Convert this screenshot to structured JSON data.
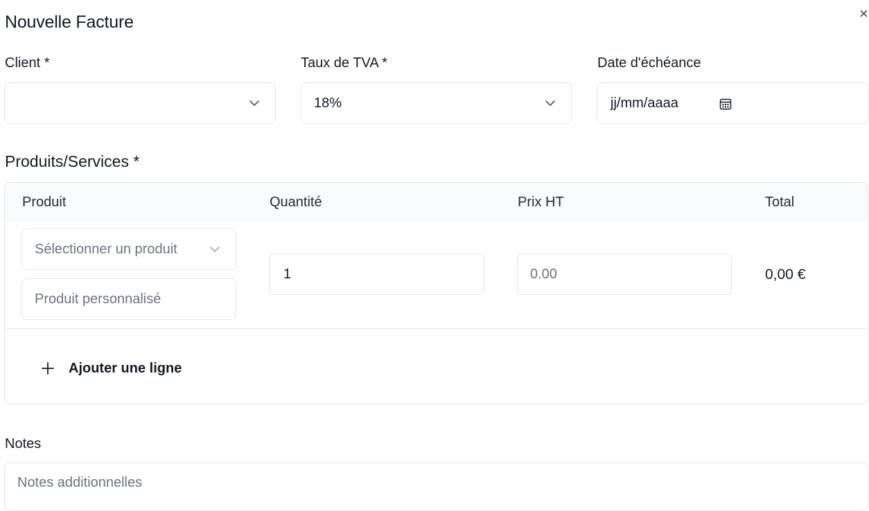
{
  "dialog": {
    "title": "Nouvelle Facture",
    "close_glyph": "×"
  },
  "form": {
    "client": {
      "label": "Client *",
      "value": ""
    },
    "tva": {
      "label": "Taux de TVA *",
      "value": "18%"
    },
    "due_date": {
      "label": "Date d'échéance",
      "placeholder": "jj/mm/aaaa",
      "icon": "calendar-icon"
    }
  },
  "products": {
    "section_title": "Produits/Services *",
    "columns": [
      "Produit",
      "Quantité",
      "Prix HT",
      "Total"
    ],
    "rows": [
      {
        "product_select_placeholder": "Sélectionner un produit",
        "custom_product_placeholder": "Produit personnalisé",
        "quantity": "1",
        "price_placeholder": "0.00",
        "total": "0,00 €"
      }
    ],
    "add_line_label": "Ajouter une ligne",
    "add_line_icon": "plus-icon"
  },
  "notes": {
    "label": "Notes",
    "placeholder": "Notes additionnelles"
  },
  "colors": {
    "border": "#e5e7eb",
    "header_bg": "#f9fafb",
    "placeholder": "#6b7280",
    "text": "#111827"
  }
}
